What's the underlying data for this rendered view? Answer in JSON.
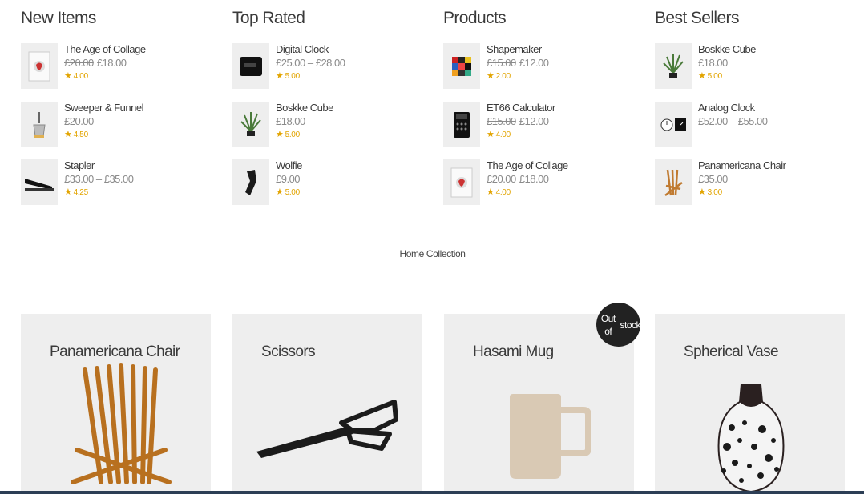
{
  "columns": [
    {
      "title": "New Items",
      "items": [
        {
          "name": "The Age of Collage",
          "old_price": "£20.00",
          "price": "£18.00",
          "rating": "4.00",
          "icon": "book-collage-icon"
        },
        {
          "name": "Sweeper & Funnel",
          "old_price": "",
          "price": "£20.00",
          "rating": "4.50",
          "icon": "funnel-icon"
        },
        {
          "name": "Stapler",
          "old_price": "",
          "price": "£33.00 – £35.00",
          "rating": "4.25",
          "icon": "stapler-icon"
        }
      ]
    },
    {
      "title": "Top Rated",
      "items": [
        {
          "name": "Digital Clock",
          "old_price": "",
          "price": "£25.00 – £28.00",
          "rating": "5.00",
          "icon": "digital-clock-icon"
        },
        {
          "name": "Boskke Cube",
          "old_price": "",
          "price": "£18.00",
          "rating": "5.00",
          "icon": "plant-cube-icon"
        },
        {
          "name": "Wolfie",
          "old_price": "",
          "price": "£9.00",
          "rating": "5.00",
          "icon": "wolfie-icon"
        }
      ]
    },
    {
      "title": "Products",
      "items": [
        {
          "name": "Shapemaker",
          "old_price": "£15.00",
          "price": "£12.00",
          "rating": "2.00",
          "icon": "shapemaker-icon"
        },
        {
          "name": "ET66 Calculator",
          "old_price": "£15.00",
          "price": "£12.00",
          "rating": "4.00",
          "icon": "calculator-icon"
        },
        {
          "name": "The Age of Collage",
          "old_price": "£20.00",
          "price": "£18.00",
          "rating": "4.00",
          "icon": "book-collage-icon"
        }
      ]
    },
    {
      "title": "Best Sellers",
      "items": [
        {
          "name": "Boskke Cube",
          "old_price": "",
          "price": "£18.00",
          "rating": "5.00",
          "icon": "plant-cube-icon"
        },
        {
          "name": "Analog Clock",
          "old_price": "",
          "price": "£52.00 – £55.00",
          "rating": "",
          "icon": "analog-clock-icon"
        },
        {
          "name": "Panamericana Chair",
          "old_price": "",
          "price": "£35.00",
          "rating": "3.00",
          "icon": "chair-icon"
        }
      ]
    }
  ],
  "divider_label": "Home Collection",
  "cards": [
    {
      "name": "Panamericana Chair",
      "icon": "wooden-chair-icon"
    },
    {
      "name": "Scissors",
      "icon": "scissors-icon"
    },
    {
      "name": "Hasami Mug",
      "icon": "mug-icon",
      "badge": "Out of stock"
    },
    {
      "name": "Spherical Vase",
      "icon": "vase-icon"
    }
  ],
  "colors": {
    "star": "#e2a400",
    "card_bg": "#eeeeee",
    "badge_bg": "#222222",
    "bottom_bar": "#2c3e55"
  }
}
